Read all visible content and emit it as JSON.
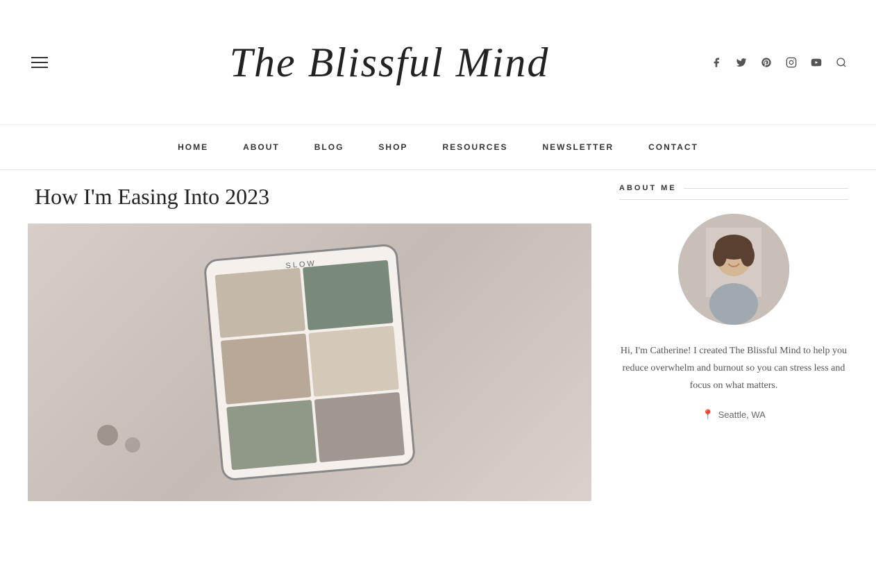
{
  "site": {
    "title": "The Blissful Mind"
  },
  "header": {
    "hamburger_label": "Menu",
    "social_icons": [
      {
        "name": "facebook-icon",
        "symbol": "f",
        "label": "Facebook"
      },
      {
        "name": "twitter-icon",
        "symbol": "t",
        "label": "Twitter"
      },
      {
        "name": "pinterest-icon",
        "symbol": "p",
        "label": "Pinterest"
      },
      {
        "name": "instagram-icon",
        "symbol": "i",
        "label": "Instagram"
      },
      {
        "name": "youtube-icon",
        "symbol": "y",
        "label": "YouTube"
      },
      {
        "name": "search-icon",
        "symbol": "🔍",
        "label": "Search"
      }
    ]
  },
  "nav": {
    "items": [
      {
        "id": "home",
        "label": "HOME"
      },
      {
        "id": "about",
        "label": "ABOUT"
      },
      {
        "id": "blog",
        "label": "BLOG"
      },
      {
        "id": "shop",
        "label": "SHOP"
      },
      {
        "id": "resources",
        "label": "RESOURCES"
      },
      {
        "id": "newsletter",
        "label": "NEWSLETTER"
      },
      {
        "id": "contact",
        "label": "CONTACT"
      }
    ]
  },
  "article": {
    "title": "How I'm Easing Into 2023",
    "image_alt": "Tablet showing mood board with SLOW text"
  },
  "sidebar": {
    "about_me": {
      "section_title": "ABOUT ME",
      "bio": "Hi, I'm Catherine! I created The Blissful Mind to help you reduce overwhelm and burnout so you can stress less and focus on what matters.",
      "location": "Seattle, WA"
    }
  }
}
